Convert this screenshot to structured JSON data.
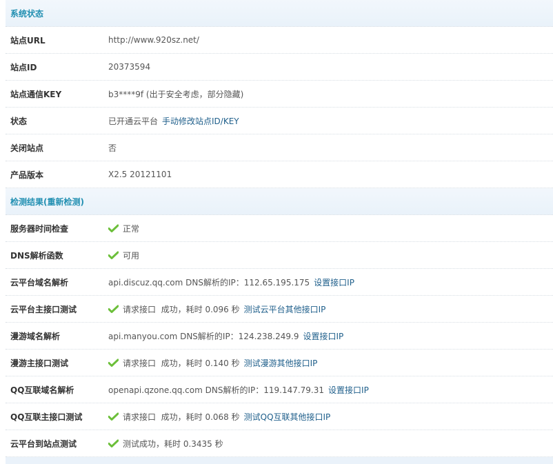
{
  "status": {
    "title": "系统状态",
    "rows": [
      {
        "label": "站点URL",
        "value": "http://www.920sz.net/"
      },
      {
        "label": "站点ID",
        "value": "20373594"
      },
      {
        "label": "站点通信KEY",
        "value": "b3****9f (出于安全考虑，部分隐藏)"
      },
      {
        "label": "状态",
        "value": "已开通云平台",
        "link": "手动修改站点ID/KEY"
      },
      {
        "label": "关闭站点",
        "value": "否"
      },
      {
        "label": "产品版本",
        "value": "X2.5 20121101"
      }
    ]
  },
  "check": {
    "title": "检测结果(重新检测)",
    "rows": [
      {
        "label": "服务器时间检查",
        "ok": true,
        "value": "正常"
      },
      {
        "label": "DNS解析函数",
        "ok": true,
        "value": "可用"
      },
      {
        "label": "云平台域名解析",
        "value": "api.discuz.qq.com DNS解析的IP：112.65.195.175",
        "link": "设置接口IP"
      },
      {
        "label": "云平台主接口测试",
        "ok": true,
        "value": "请求接口  成功，耗时 0.096 秒",
        "link": "测试云平台其他接口IP"
      },
      {
        "label": "漫游域名解析",
        "value": "api.manyou.com DNS解析的IP：124.238.249.9",
        "link": "设置接口IP"
      },
      {
        "label": "漫游主接口测试",
        "ok": true,
        "value": "请求接口  成功，耗时 0.140 秒",
        "link": "测试漫游其他接口IP"
      },
      {
        "label": "QQ互联域名解析",
        "value": "openapi.qzone.qq.com DNS解析的IP：119.147.79.31",
        "link": "设置接口IP"
      },
      {
        "label": "QQ互联主接口测试",
        "ok": true,
        "value": "请求接口  成功，耗时 0.068 秒",
        "link": "测试QQ互联其他接口IP"
      },
      {
        "label": "云平台到站点测试",
        "ok": true,
        "value": "测试成功，耗时 0.3435 秒"
      }
    ]
  }
}
